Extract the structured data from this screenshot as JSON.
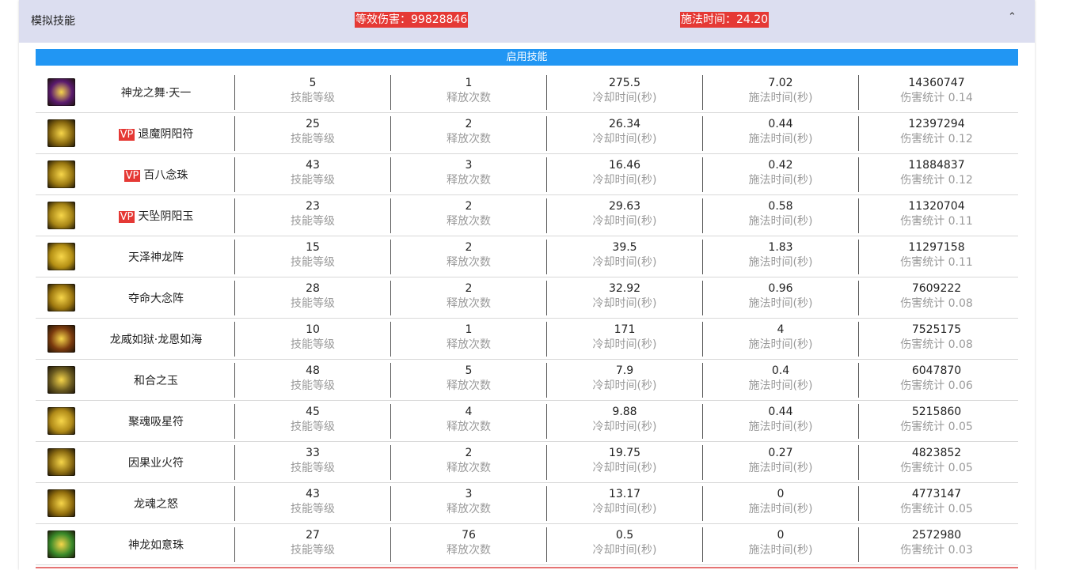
{
  "header": {
    "title": "模拟技能",
    "damage": "等效伤害：99828846",
    "cast_time": "施法时间：24.20",
    "collapse_icon": "chevron-up-icon"
  },
  "section": {
    "title": "启用技能"
  },
  "labels": {
    "level": "技能等级",
    "count": "释放次数",
    "cooldown": "冷却时间(秒)",
    "cast": "施法时间(秒)",
    "damage": "伤害统计"
  },
  "vp_tag": "VP",
  "skills": [
    {
      "name": "神龙之舞·天一",
      "vp": false,
      "level": "5",
      "count": "1",
      "cooldown": "275.5",
      "cast": "7.02",
      "damage": "14360747",
      "ratio": "伤害统计 0.14",
      "icon_color": "#5a1a6e"
    },
    {
      "name": "退魔阴阳符",
      "vp": true,
      "level": "25",
      "count": "2",
      "cooldown": "26.34",
      "cast": "0.44",
      "damage": "12397294",
      "ratio": "伤害统计 0.12",
      "icon_color": "#8a6a10"
    },
    {
      "name": "百八念珠",
      "vp": true,
      "level": "43",
      "count": "3",
      "cooldown": "16.46",
      "cast": "0.42",
      "damage": "11884837",
      "ratio": "伤害统计 0.12",
      "icon_color": "#9c7a12"
    },
    {
      "name": "天坠阴阳玉",
      "vp": true,
      "level": "23",
      "count": "2",
      "cooldown": "29.63",
      "cast": "0.58",
      "damage": "11320704",
      "ratio": "伤害统计 0.11",
      "icon_color": "#a88616"
    },
    {
      "name": "天泽神龙阵",
      "vp": false,
      "level": "15",
      "count": "2",
      "cooldown": "39.5",
      "cast": "1.83",
      "damage": "11297158",
      "ratio": "伤害统计 0.11",
      "icon_color": "#b59014"
    },
    {
      "name": "夺命大念阵",
      "vp": false,
      "level": "28",
      "count": "2",
      "cooldown": "32.92",
      "cast": "0.96",
      "damage": "7609222",
      "ratio": "伤害统计 0.08",
      "icon_color": "#a07a10"
    },
    {
      "name": "龙威如狱·龙恩如海",
      "vp": false,
      "level": "10",
      "count": "1",
      "cooldown": "171",
      "cast": "4",
      "damage": "7525175",
      "ratio": "伤害统计 0.08",
      "icon_color": "#7a3a0e"
    },
    {
      "name": "和合之玉",
      "vp": false,
      "level": "48",
      "count": "5",
      "cooldown": "7.9",
      "cast": "0.4",
      "damage": "6047870",
      "ratio": "伤害统计 0.06",
      "icon_color": "#6a5a20"
    },
    {
      "name": "聚魂吸星符",
      "vp": false,
      "level": "45",
      "count": "4",
      "cooldown": "9.88",
      "cast": "0.44",
      "damage": "5215860",
      "ratio": "伤害统计 0.05",
      "icon_color": "#b08a18"
    },
    {
      "name": "因果业火符",
      "vp": false,
      "level": "33",
      "count": "2",
      "cooldown": "19.75",
      "cast": "0.27",
      "damage": "4823852",
      "ratio": "伤害统计 0.05",
      "icon_color": "#8c6c12"
    },
    {
      "name": "龙魂之怒",
      "vp": false,
      "level": "43",
      "count": "3",
      "cooldown": "13.17",
      "cast": "0",
      "damage": "4773147",
      "ratio": "伤害统计 0.05",
      "icon_color": "#94700e"
    },
    {
      "name": "神龙如意珠",
      "vp": false,
      "level": "27",
      "count": "76",
      "cooldown": "0.5",
      "cast": "0",
      "damage": "2572980",
      "ratio": "伤害统计 0.03",
      "icon_color": "#3a8a2a"
    }
  ]
}
